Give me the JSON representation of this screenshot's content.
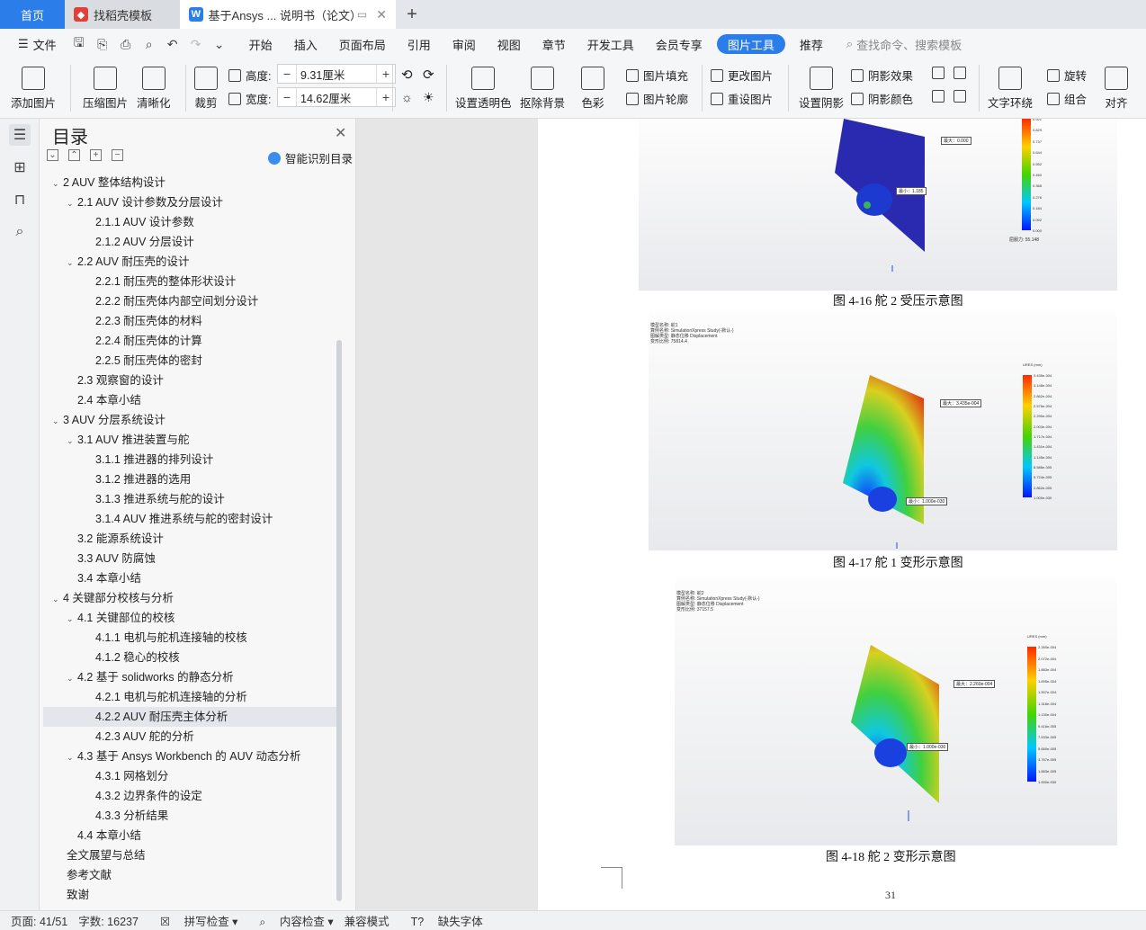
{
  "tabs": {
    "home": "首页",
    "template": "找稻壳模板",
    "document": "基于Ansys ... 说明书（论文）"
  },
  "menu": {
    "file": "文件",
    "items": [
      "开始",
      "插入",
      "页面布局",
      "引用",
      "审阅",
      "视图",
      "章节",
      "开发工具",
      "会员专享",
      "图片工具",
      "推荐"
    ],
    "active": "图片工具",
    "search": "查找命令、搜索模板"
  },
  "ribbon": {
    "add_image": "添加图片",
    "compress": "压缩图片",
    "sharpen": "清晰化",
    "crop": "裁剪",
    "height_label": "高度:",
    "height_value": "9.31厘米",
    "width_label": "宽度:",
    "width_value": "14.62厘米",
    "set_transparent": "设置透明色",
    "remove_bg": "抠除背景",
    "color": "色彩",
    "image_fill": "图片填充",
    "image_outline": "图片轮廓",
    "change_image": "更改图片",
    "reset_image": "重设图片",
    "set_shadow": "设置阴影",
    "shadow_effect": "阴影效果",
    "shadow_color": "阴影颜色",
    "text_wrap": "文字环绕",
    "rotate": "旋转",
    "group": "组合",
    "align": "对齐"
  },
  "toc": {
    "title": "目录",
    "smart": "智能识别目录",
    "items": [
      {
        "text": "2 AUV 整体结构设计",
        "level": 1,
        "arrow": true
      },
      {
        "text": "2.1 AUV 设计参数及分层设计",
        "level": 2,
        "arrow": true
      },
      {
        "text": "2.1.1 AUV 设计参数",
        "level": 3
      },
      {
        "text": "2.1.2 AUV 分层设计",
        "level": 3
      },
      {
        "text": "2.2 AUV 耐压壳的设计",
        "level": 2,
        "arrow": true
      },
      {
        "text": "2.2.1  耐压壳的整体形状设计",
        "level": 3
      },
      {
        "text": "2.2.2  耐压壳体内部空间划分设计",
        "level": 3
      },
      {
        "text": "2.2.3  耐压壳体的材料",
        "level": 3
      },
      {
        "text": "2.2.4  耐压壳体的计算",
        "level": 3
      },
      {
        "text": "2.2.5  耐压壳体的密封",
        "level": 3
      },
      {
        "text": "2.3  观察窗的设计",
        "level": 2
      },
      {
        "text": "2.4  本章小结",
        "level": 2
      },
      {
        "text": "3 AUV 分层系统设计",
        "level": 1,
        "arrow": true
      },
      {
        "text": "3.1 AUV 推进装置与舵",
        "level": 2,
        "arrow": true
      },
      {
        "text": "3.1.1  推进器的排列设计",
        "level": 3
      },
      {
        "text": "3.1.2  推进器的选用",
        "level": 3
      },
      {
        "text": "3.1.3  推进系统与舵的设计",
        "level": 3
      },
      {
        "text": "3.1.4 AUV 推进系统与舵的密封设计",
        "level": 3
      },
      {
        "text": "3.2  能源系统设计",
        "level": 2
      },
      {
        "text": "3.3 AUV 防腐蚀",
        "level": 2
      },
      {
        "text": "3.4  本章小结",
        "level": 2
      },
      {
        "text": "4  关键部分校核与分析",
        "level": 1,
        "arrow": true
      },
      {
        "text": "4.1  关键部位的校核",
        "level": 2,
        "arrow": true
      },
      {
        "text": "4.1.1  电机与舵机连接轴的校核",
        "level": 3
      },
      {
        "text": "4.1.2  稳心的校核",
        "level": 3
      },
      {
        "text": "4.2  基于 solidworks 的静态分析",
        "level": 2,
        "arrow": true
      },
      {
        "text": "4.2.1 电机与舵机连接轴的分析",
        "level": 3
      },
      {
        "text": "4.2.2 AUV 耐压壳主体分析",
        "level": 3,
        "selected": true
      },
      {
        "text": "4.2.3 AUV 舵的分析",
        "level": 3
      },
      {
        "text": "4.3  基于 Ansys Workbench 的 AUV 动态分析",
        "level": 2,
        "arrow": true
      },
      {
        "text": "4.3.1  网格划分",
        "level": 3
      },
      {
        "text": "4.3.2  边界条件的设定",
        "level": 3
      },
      {
        "text": "4.3.3  分析结果",
        "level": 3
      },
      {
        "text": "4.4  本章小结",
        "level": 2
      },
      {
        "text": "全文展望与总结",
        "level": 0
      },
      {
        "text": "参考文献",
        "level": 0
      },
      {
        "text": "致谢",
        "level": 0
      }
    ]
  },
  "figures": {
    "fig1": {
      "caption": "图 4-16  舵 2 受压示意图",
      "legend": [
        "0.921",
        "0.829",
        "0.737",
        "0.644",
        "0.552",
        "0.460",
        "0.368",
        "0.276",
        "0.184",
        "0.092",
        "0.000"
      ],
      "label_max": "最大：0.000",
      "label_min": "最小：1.185",
      "pressure": "屈服力: 55.148"
    },
    "fig2": {
      "caption": "图 4-17  舵 1 变形示意图",
      "header": [
        "模型名称: 舵1",
        "算例名称: SimulationXpress Study(-默认-)",
        "图解类型: 静态位移 Displacement",
        "变形比例: 75814.4"
      ],
      "legend_title": "URES (mm)",
      "legend": [
        "3.435e-004",
        "3.148e-004",
        "2.862e-004",
        "2.576e-004",
        "2.290e-004",
        "2.003e-004",
        "1.717e-004",
        "1.431e-004",
        "1.145e-004",
        "8.586e-005",
        "5.724e-005",
        "2.862e-005",
        "1.000e-030"
      ],
      "label_max": "最大：3.435e-004",
      "label_min": "最小：1.000e-030"
    },
    "fig3": {
      "caption": "图 4-18  舵 2 变形示意图",
      "header": [
        "模型名称: 舵2",
        "算例名称: SimulationXpress Study(-默认-)",
        "图解类型: 静态位移 Displacement",
        "变形比例: 37157.5"
      ],
      "legend_title": "URES (mm)",
      "legend": [
        "2.260e-004",
        "2.072e-004",
        "1.883e-004",
        "1.695e-004",
        "1.507e-004",
        "1.318e-004",
        "1.130e-004",
        "9.416e-005",
        "7.533e-005",
        "5.650e-005",
        "3.767e-005",
        "1.883e-005",
        "1.000e-030"
      ],
      "label_max": "最大：2.260e-004",
      "label_min": "最小：1.000e-030"
    }
  },
  "page_number": "31",
  "status": {
    "page": "页面: 41/51",
    "words": "字数: 16237",
    "spell": "拼写检查",
    "content": "内容检查",
    "compat": "兼容模式",
    "missing_font": "缺失字体"
  }
}
